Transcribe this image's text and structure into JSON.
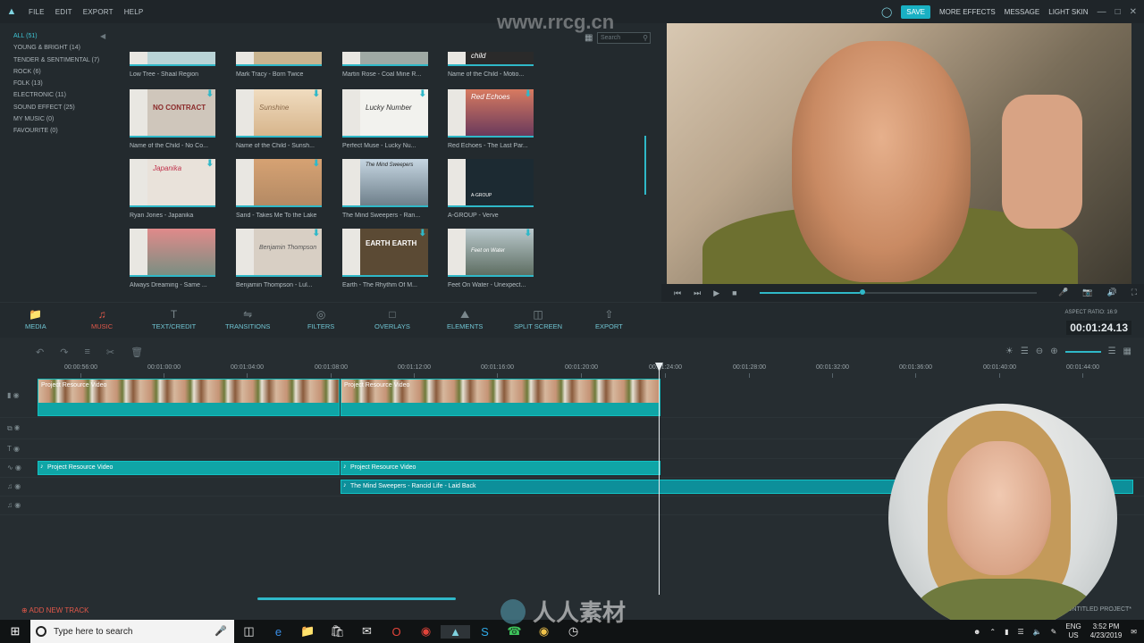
{
  "menu": {
    "items": [
      "FILE",
      "EDIT",
      "EXPORT",
      "HELP"
    ]
  },
  "top_right": {
    "save": "SAVE",
    "more_effects": "MORE EFFECTS",
    "message": "MESSAGE",
    "light_skin": "LIGHT SKIN"
  },
  "library": {
    "categories": [
      "ALL (51)",
      "YOUNG & BRIGHT (14)",
      "TENDER & SENTIMENTAL (7)",
      "ROCK (6)",
      "FOLK (13)",
      "ELECTRONIC (11)",
      "SOUND EFFECT (25)",
      "MY MUSIC (0)",
      "FAVOURITE (0)"
    ],
    "search_placeholder": "Search",
    "tracks": [
      {
        "title": "Low Tree - Shaal Region",
        "color": "#b9d3d6"
      },
      {
        "title": "Mark Tracy - Born Twice",
        "color": "#c9b48f"
      },
      {
        "title": "Martin Rose - Coal Mine R...",
        "color": "#9fa9a4"
      },
      {
        "title": "Name of the Child - Motio...",
        "color": "#2a2a2a"
      },
      {
        "title": "Name of the Child - No Co...",
        "color": "#cfc6bb"
      },
      {
        "title": "Name of the Child - Sunsh...",
        "color": "#e7cfa9"
      },
      {
        "title": "Perfect Muse - Lucky Nu...",
        "color": "#f2f2ee"
      },
      {
        "title": "Red Echoes - The Last Par...",
        "color": "#b14a57"
      },
      {
        "title": "Ryan Jones - Japanika",
        "color": "#d76e8a"
      },
      {
        "title": "Sand - Takes Me To the Lake",
        "color": "#d49a6a"
      },
      {
        "title": "The Mind Sweepers - Ran...",
        "color": "#8fb0c8"
      },
      {
        "title": "A-GROUP - Verve",
        "color": "#1c2a32"
      },
      {
        "title": "Always Dreaming - Same ...",
        "color": "#d27884"
      },
      {
        "title": "Benjamin Thompson - Lul...",
        "color": "#d8cfc4"
      },
      {
        "title": "Earth - The Rhythm Of M...",
        "color": "#5b4a34"
      },
      {
        "title": "Feet On Water - Unexpect...",
        "color": "#6e8a96"
      }
    ],
    "art_text": {
      "motion": "child",
      "no_contract": "NO CONTRACT",
      "sunshine": "Sunshine",
      "lucky": "Lucky Number",
      "red_echoes": "Red Echoes",
      "japanika": "Japanika",
      "mind_sweepers": "The Mind Sweepers",
      "agroup": "A-GROUP",
      "benjamin": "Benjamin Thompson",
      "earth": "EARTH EARTH",
      "feet": "Feet on Water"
    }
  },
  "toolbar": {
    "tabs": [
      "MEDIA",
      "MUSIC",
      "TEXT/CREDIT",
      "TRANSITIONS",
      "FILTERS",
      "OVERLAYS",
      "ELEMENTS",
      "SPLIT SCREEN",
      "EXPORT"
    ],
    "active_tab": "MUSIC",
    "aspect_ratio": "ASPECT RATIO: 16:9",
    "timecode": "00:01:24.13"
  },
  "timeline": {
    "ticks": [
      "00:00:56:00",
      "00:01:00:00",
      "00:01:04:00",
      "00:01:08:00",
      "00:01:12:00",
      "00:01:16:00",
      "00:01:20:00",
      "00:01:24:00",
      "00:01:28:00",
      "00:01:32:00",
      "00:01:36:00",
      "00:01:40:00",
      "00:01:44:00"
    ],
    "video_clip_label_1": "Project Resource Video",
    "video_clip_label_2": "Project Resource Video",
    "audio_clip_1": "Project Resource Video",
    "audio_clip_2": "Project Resource Video",
    "music_clip": "The Mind Sweepers - Rancid Life - Laid Back",
    "add_track": "ADD NEW TRACK",
    "project_name": "UNTITLED PROJECT*"
  },
  "watermark": {
    "site": "www.rrcg.cn",
    "brand": "人人素材"
  },
  "taskbar": {
    "search_placeholder": "Type here to search",
    "lang_1": "ENG",
    "lang_2": "US",
    "time": "3:52 PM",
    "date": "4/23/2019"
  },
  "colors": {
    "accent": "#2fb8c8",
    "active_tab": "#e2584a",
    "clip": "#0fa5a6"
  }
}
